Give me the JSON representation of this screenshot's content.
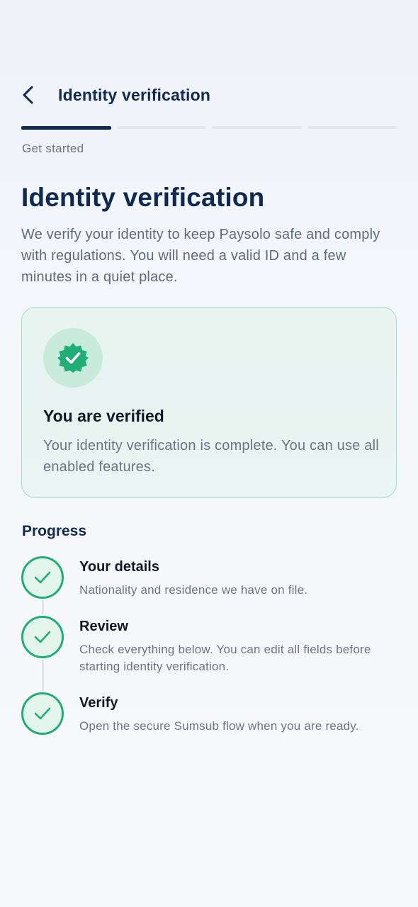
{
  "header": {
    "title": "Identity verification"
  },
  "stepper": {
    "total_steps": 4,
    "active_step": 1,
    "current_label": "Get started"
  },
  "main": {
    "title": "Identity verification",
    "intro": "We verify your identity to keep Paysolo safe and comply with regulations. You will need a valid ID and a few minutes in a quiet place."
  },
  "status_card": {
    "icon": "verified-badge-icon",
    "title": "You are verified",
    "text": "Your identity verification is complete. You can use all enabled features."
  },
  "progress": {
    "heading": "Progress",
    "steps": [
      {
        "title": "Your details",
        "description": "Nationality and residence we have on file.",
        "status": "complete"
      },
      {
        "title": "Review",
        "description": "Check everything below. You can edit all fields before starting identity verification.",
        "status": "complete"
      },
      {
        "title": "Verify",
        "description": "Open the secure Sumsub flow when you are ready.",
        "status": "complete"
      }
    ]
  },
  "colors": {
    "primary": "#0f2a52",
    "success": "#1fae76",
    "card_border": "#a7ddc6",
    "card_bg": "#e7f4f0"
  }
}
